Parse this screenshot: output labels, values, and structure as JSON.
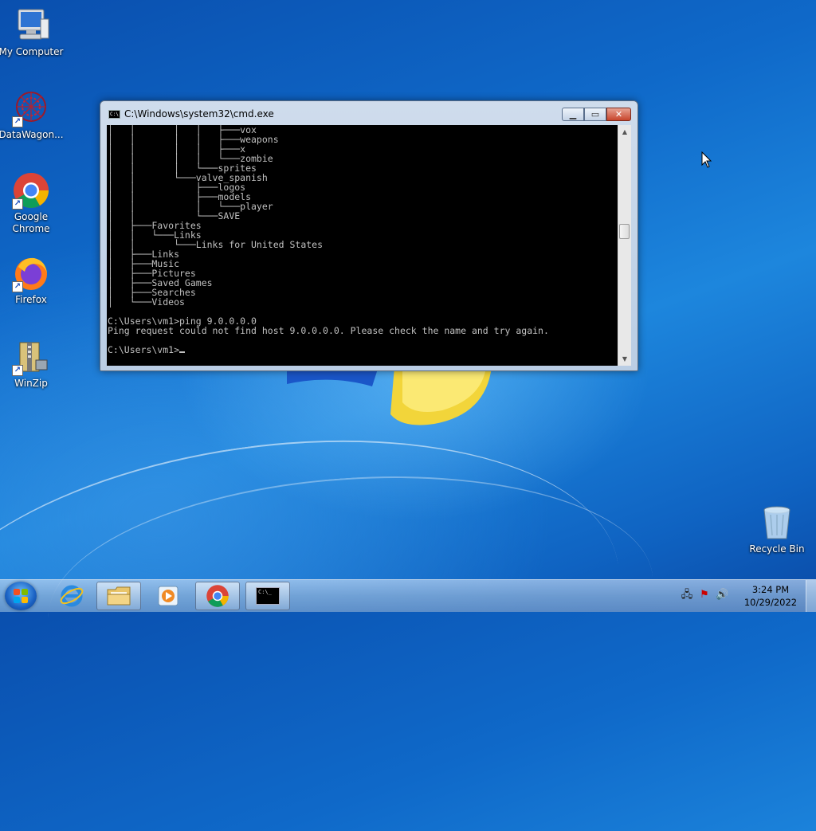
{
  "desktop_icons": [
    {
      "label": "My Computer",
      "icon": "computer-icon"
    },
    {
      "label": "DataWagon...",
      "icon": "datawagon-icon"
    },
    {
      "label": "Google Chrome",
      "icon": "chrome-icon"
    },
    {
      "label": "Firefox",
      "icon": "firefox-icon"
    },
    {
      "label": "WinZip",
      "icon": "winzip-icon"
    },
    {
      "label": "Recycle Bin",
      "icon": "recycle-bin-icon"
    }
  ],
  "cmd": {
    "title": "C:\\Windows\\system32\\cmd.exe",
    "lines": [
      "│   │       │   │   ├───vox",
      "│   │       │   │   ├───weapons",
      "│   │       │   │   ├───x",
      "│   │       │   │   └───zombie",
      "│   │       │   └───sprites",
      "│   │       └───valve_spanish",
      "│   │           ├───logos",
      "│   │           ├───models",
      "│   │           │   └───player",
      "│   │           └───SAVE",
      "│   ├───Favorites",
      "│   │   └───Links",
      "│   │       └───Links for United States",
      "│   ├───Links",
      "│   ├───Music",
      "│   ├───Pictures",
      "│   ├───Saved Games",
      "│   ├───Searches",
      "│   └───Videos",
      "",
      "C:\\Users\\vm1>ping 9.0.0.0.0",
      "Ping request could not find host 9.0.0.0.0. Please check the name and try again.",
      "",
      "C:\\Users\\vm1>"
    ]
  },
  "taskbar": {
    "items": [
      {
        "name": "internet-explorer",
        "icon": "internet-explorer-icon",
        "open": false
      },
      {
        "name": "windows-explorer",
        "icon": "folder-icon",
        "open": true
      },
      {
        "name": "media-player",
        "icon": "media-player-icon",
        "open": false
      },
      {
        "name": "google-chrome",
        "icon": "chrome-icon",
        "open": true
      },
      {
        "name": "command-prompt",
        "icon": "cmd-icon",
        "open": true
      }
    ],
    "time": "3:24 PM",
    "date": "10/29/2022"
  },
  "colors": {
    "terminal_bg": "#000000",
    "terminal_fg": "#c0c0c0",
    "wallpaper": "#0f69c9"
  }
}
